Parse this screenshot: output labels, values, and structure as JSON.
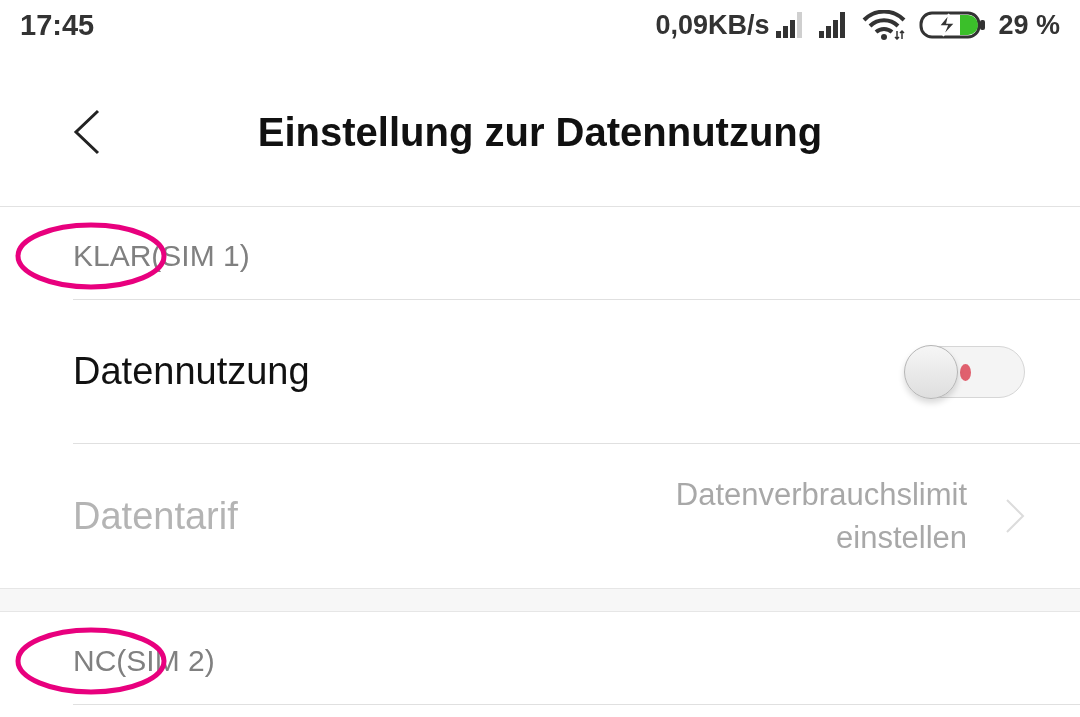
{
  "status_bar": {
    "time": "17:45",
    "network_speed": "0,09KB/s",
    "battery": "29 %"
  },
  "header": {
    "title": "Einstellung zur Datennutzung"
  },
  "sections": [
    {
      "title": "KLAR(SIM 1)",
      "highlighted": true,
      "rows": [
        {
          "kind": "toggle",
          "label": "Datennutzung",
          "on": false,
          "disabled": false
        },
        {
          "kind": "link",
          "label": "Datentarif",
          "value": "Datenverbrauchslimit einstellen",
          "disabled": true
        }
      ]
    },
    {
      "title": "NC(SIM 2)",
      "highlighted": true
    }
  ]
}
